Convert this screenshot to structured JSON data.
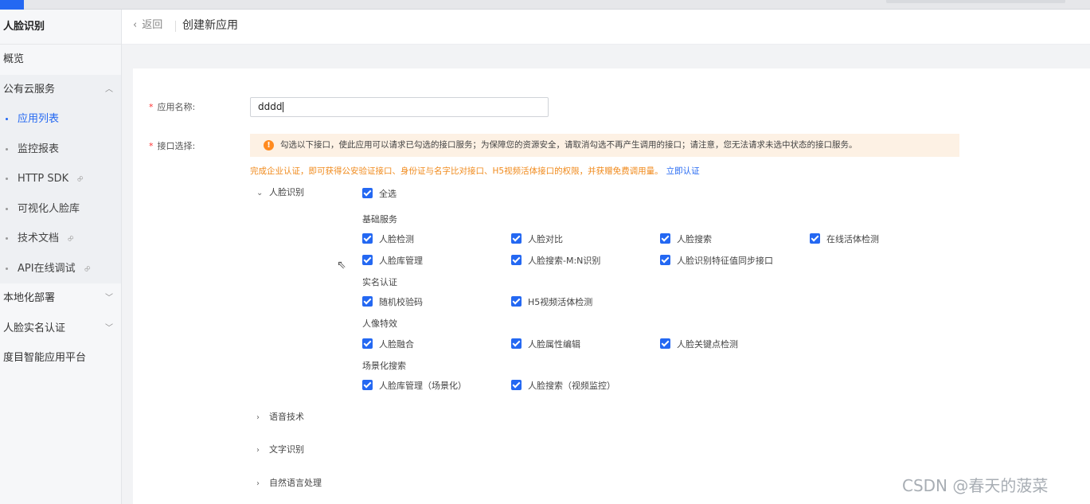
{
  "sidebar": {
    "product_title": "人脸识别",
    "items": [
      {
        "label": "概览"
      },
      {
        "label": "公有云服务",
        "chevron": "^"
      },
      {
        "label": "应用列表",
        "active": true
      },
      {
        "label": "监控报表"
      },
      {
        "label": "HTTP SDK",
        "icon": "link-icon"
      },
      {
        "label": "可视化人脸库"
      },
      {
        "label": "技术文档",
        "icon": "link-icon"
      },
      {
        "label": "API在线调试",
        "icon": "link-icon"
      },
      {
        "label": "本地化部署",
        "chevron": "v"
      },
      {
        "label": "人脸实名认证",
        "chevron": "v"
      },
      {
        "label": "度目智能应用平台"
      }
    ]
  },
  "header": {
    "back_label": "返回",
    "title": "创建新应用"
  },
  "form": {
    "name_label": "应用名称:",
    "name_value": "dddd",
    "api_label": "接口选择:",
    "notice": "勾选以下接口，使此应用可以请求已勾选的接口服务；为保障您的资源安全，请取消勾选不再产生调用的接口；请注意，您无法请求未选中状态的接口服务。",
    "promo": "完成企业认证，即可获得公安验证接口、身份证与名字比对接口、H5视频活体接口的权限，并获赠免费调用量。",
    "promo_link": "立即认证"
  },
  "categories": {
    "face": {
      "label": "人脸识别",
      "select_all": "全选",
      "groups": [
        {
          "title": "基础服务",
          "items": [
            "人脸检测",
            "人脸对比",
            "人脸搜索",
            "在线活体检测",
            "人脸库管理",
            "人脸搜索-M:N识别",
            "人脸识别特征值同步接口"
          ]
        },
        {
          "title": "实名认证",
          "items": [
            "随机校验码",
            "H5视频活体检测"
          ]
        },
        {
          "title": "人像特效",
          "items": [
            "人脸融合",
            "人脸属性编辑",
            "人脸关键点检测"
          ]
        },
        {
          "title": "场景化搜索",
          "items": [
            "人脸库管理（场景化）",
            "人脸搜索（视频监控）"
          ]
        }
      ]
    },
    "collapsed": [
      "语音技术",
      "文字识别",
      "自然语言处理"
    ]
  },
  "watermark": "CSDN @春天的菠菜",
  "colors": {
    "primary": "#2468f2",
    "warning": "#ff8a1f",
    "promo": "#f08a1c",
    "notice_bg": "#fdf1e4"
  }
}
